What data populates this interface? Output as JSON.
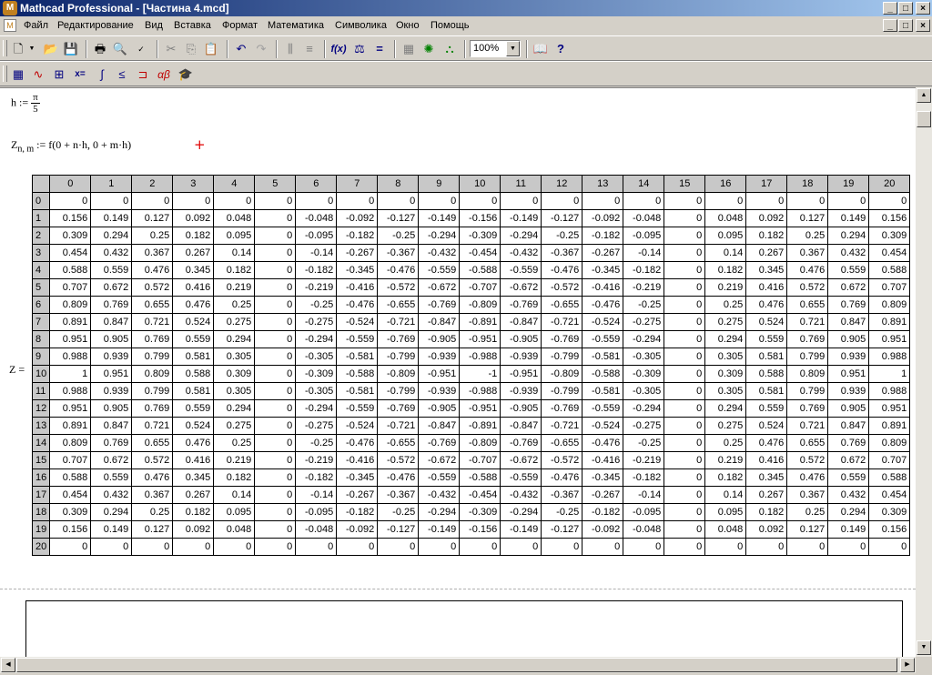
{
  "window": {
    "title": "Mathcad Professional - [Частина 4.mcd]",
    "minimize_glyph": "_",
    "maximize_glyph": "□",
    "close_glyph": "×"
  },
  "menu": [
    "Файл",
    "Редактирование",
    "Вид",
    "Вставка",
    "Формат",
    "Математика",
    "Символика",
    "Окно",
    "Помощь"
  ],
  "toolbar": {
    "zoom_value": "100%",
    "standard_icons": [
      "new-document-icon",
      "open-folder-icon",
      "save-icon",
      "print-icon",
      "print-preview-icon",
      "spell-check-icon",
      "cut-icon",
      "copy-icon",
      "paste-icon",
      "undo-icon",
      "redo-icon",
      "align-horizontal-icon",
      "align-vertical-icon",
      "insert-function-icon",
      "insert-unit-icon",
      "calculate-icon",
      "component-icon",
      "resource-icon",
      "help-icon"
    ],
    "math_icons": [
      "calculator-palette-icon",
      "graph-palette-icon",
      "matrix-palette-icon",
      "evaluation-palette-icon",
      "calculus-palette-icon",
      "boolean-palette-icon",
      "programming-palette-icon",
      "greek-palette-icon",
      "symbolic-palette-icon"
    ]
  },
  "worksheet": {
    "h_def": {
      "lhs": "h",
      "assign": ":=",
      "num": "π",
      "den": "5"
    },
    "z_def": {
      "lhs": "Z",
      "sub": "n, m",
      "assign": ":=",
      "rhs": "f(0 + n·h, 0 + m·h)"
    },
    "cursor_glyph": "+",
    "matrix_label": "Z =",
    "matrix": {
      "columns": [
        "0",
        "1",
        "2",
        "3",
        "4",
        "5",
        "6",
        "7",
        "8",
        "9",
        "10",
        "11",
        "12",
        "13",
        "14",
        "15",
        "16",
        "17",
        "18",
        "19",
        "20"
      ],
      "rows": [
        [
          "0",
          "0",
          "0",
          "0",
          "0",
          "0",
          "0",
          "0",
          "0",
          "0",
          "0",
          "0",
          "0",
          "0",
          "0",
          "0",
          "0",
          "0",
          "0",
          "0",
          "0"
        ],
        [
          "0.156",
          "0.149",
          "0.127",
          "0.092",
          "0.048",
          "0",
          "-0.048",
          "-0.092",
          "-0.127",
          "-0.149",
          "-0.156",
          "-0.149",
          "-0.127",
          "-0.092",
          "-0.048",
          "0",
          "0.048",
          "0.092",
          "0.127",
          "0.149",
          "0.156"
        ],
        [
          "0.309",
          "0.294",
          "0.25",
          "0.182",
          "0.095",
          "0",
          "-0.095",
          "-0.182",
          "-0.25",
          "-0.294",
          "-0.309",
          "-0.294",
          "-0.25",
          "-0.182",
          "-0.095",
          "0",
          "0.095",
          "0.182",
          "0.25",
          "0.294",
          "0.309"
        ],
        [
          "0.454",
          "0.432",
          "0.367",
          "0.267",
          "0.14",
          "0",
          "-0.14",
          "-0.267",
          "-0.367",
          "-0.432",
          "-0.454",
          "-0.432",
          "-0.367",
          "-0.267",
          "-0.14",
          "0",
          "0.14",
          "0.267",
          "0.367",
          "0.432",
          "0.454"
        ],
        [
          "0.588",
          "0.559",
          "0.476",
          "0.345",
          "0.182",
          "0",
          "-0.182",
          "-0.345",
          "-0.476",
          "-0.559",
          "-0.588",
          "-0.559",
          "-0.476",
          "-0.345",
          "-0.182",
          "0",
          "0.182",
          "0.345",
          "0.476",
          "0.559",
          "0.588"
        ],
        [
          "0.707",
          "0.672",
          "0.572",
          "0.416",
          "0.219",
          "0",
          "-0.219",
          "-0.416",
          "-0.572",
          "-0.672",
          "-0.707",
          "-0.672",
          "-0.572",
          "-0.416",
          "-0.219",
          "0",
          "0.219",
          "0.416",
          "0.572",
          "0.672",
          "0.707"
        ],
        [
          "0.809",
          "0.769",
          "0.655",
          "0.476",
          "0.25",
          "0",
          "-0.25",
          "-0.476",
          "-0.655",
          "-0.769",
          "-0.809",
          "-0.769",
          "-0.655",
          "-0.476",
          "-0.25",
          "0",
          "0.25",
          "0.476",
          "0.655",
          "0.769",
          "0.809"
        ],
        [
          "0.891",
          "0.847",
          "0.721",
          "0.524",
          "0.275",
          "0",
          "-0.275",
          "-0.524",
          "-0.721",
          "-0.847",
          "-0.891",
          "-0.847",
          "-0.721",
          "-0.524",
          "-0.275",
          "0",
          "0.275",
          "0.524",
          "0.721",
          "0.847",
          "0.891"
        ],
        [
          "0.951",
          "0.905",
          "0.769",
          "0.559",
          "0.294",
          "0",
          "-0.294",
          "-0.559",
          "-0.769",
          "-0.905",
          "-0.951",
          "-0.905",
          "-0.769",
          "-0.559",
          "-0.294",
          "0",
          "0.294",
          "0.559",
          "0.769",
          "0.905",
          "0.951"
        ],
        [
          "0.988",
          "0.939",
          "0.799",
          "0.581",
          "0.305",
          "0",
          "-0.305",
          "-0.581",
          "-0.799",
          "-0.939",
          "-0.988",
          "-0.939",
          "-0.799",
          "-0.581",
          "-0.305",
          "0",
          "0.305",
          "0.581",
          "0.799",
          "0.939",
          "0.988"
        ],
        [
          "1",
          "0.951",
          "0.809",
          "0.588",
          "0.309",
          "0",
          "-0.309",
          "-0.588",
          "-0.809",
          "-0.951",
          "-1",
          "-0.951",
          "-0.809",
          "-0.588",
          "-0.309",
          "0",
          "0.309",
          "0.588",
          "0.809",
          "0.951",
          "1"
        ],
        [
          "0.988",
          "0.939",
          "0.799",
          "0.581",
          "0.305",
          "0",
          "-0.305",
          "-0.581",
          "-0.799",
          "-0.939",
          "-0.988",
          "-0.939",
          "-0.799",
          "-0.581",
          "-0.305",
          "0",
          "0.305",
          "0.581",
          "0.799",
          "0.939",
          "0.988"
        ],
        [
          "0.951",
          "0.905",
          "0.769",
          "0.559",
          "0.294",
          "0",
          "-0.294",
          "-0.559",
          "-0.769",
          "-0.905",
          "-0.951",
          "-0.905",
          "-0.769",
          "-0.559",
          "-0.294",
          "0",
          "0.294",
          "0.559",
          "0.769",
          "0.905",
          "0.951"
        ],
        [
          "0.891",
          "0.847",
          "0.721",
          "0.524",
          "0.275",
          "0",
          "-0.275",
          "-0.524",
          "-0.721",
          "-0.847",
          "-0.891",
          "-0.847",
          "-0.721",
          "-0.524",
          "-0.275",
          "0",
          "0.275",
          "0.524",
          "0.721",
          "0.847",
          "0.891"
        ],
        [
          "0.809",
          "0.769",
          "0.655",
          "0.476",
          "0.25",
          "0",
          "-0.25",
          "-0.476",
          "-0.655",
          "-0.769",
          "-0.809",
          "-0.769",
          "-0.655",
          "-0.476",
          "-0.25",
          "0",
          "0.25",
          "0.476",
          "0.655",
          "0.769",
          "0.809"
        ],
        [
          "0.707",
          "0.672",
          "0.572",
          "0.416",
          "0.219",
          "0",
          "-0.219",
          "-0.416",
          "-0.572",
          "-0.672",
          "-0.707",
          "-0.672",
          "-0.572",
          "-0.416",
          "-0.219",
          "0",
          "0.219",
          "0.416",
          "0.572",
          "0.672",
          "0.707"
        ],
        [
          "0.588",
          "0.559",
          "0.476",
          "0.345",
          "0.182",
          "0",
          "-0.182",
          "-0.345",
          "-0.476",
          "-0.559",
          "-0.588",
          "-0.559",
          "-0.476",
          "-0.345",
          "-0.182",
          "0",
          "0.182",
          "0.345",
          "0.476",
          "0.559",
          "0.588"
        ],
        [
          "0.454",
          "0.432",
          "0.367",
          "0.267",
          "0.14",
          "0",
          "-0.14",
          "-0.267",
          "-0.367",
          "-0.432",
          "-0.454",
          "-0.432",
          "-0.367",
          "-0.267",
          "-0.14",
          "0",
          "0.14",
          "0.267",
          "0.367",
          "0.432",
          "0.454"
        ],
        [
          "0.309",
          "0.294",
          "0.25",
          "0.182",
          "0.095",
          "0",
          "-0.095",
          "-0.182",
          "-0.25",
          "-0.294",
          "-0.309",
          "-0.294",
          "-0.25",
          "-0.182",
          "-0.095",
          "0",
          "0.095",
          "0.182",
          "0.25",
          "0.294",
          "0.309"
        ],
        [
          "0.156",
          "0.149",
          "0.127",
          "0.092",
          "0.048",
          "0",
          "-0.048",
          "-0.092",
          "-0.127",
          "-0.149",
          "-0.156",
          "-0.149",
          "-0.127",
          "-0.092",
          "-0.048",
          "0",
          "0.048",
          "0.092",
          "0.127",
          "0.149",
          "0.156"
        ],
        [
          "0",
          "0",
          "0",
          "0",
          "0",
          "0",
          "0",
          "0",
          "0",
          "0",
          "0",
          "0",
          "0",
          "0",
          "0",
          "0",
          "0",
          "0",
          "0",
          "0",
          "0"
        ]
      ]
    }
  },
  "colors": {
    "titlebar_start": "#0a246a",
    "titlebar_end": "#a6caf0",
    "chrome": "#d4d0c8",
    "cursor": "#e00000"
  }
}
